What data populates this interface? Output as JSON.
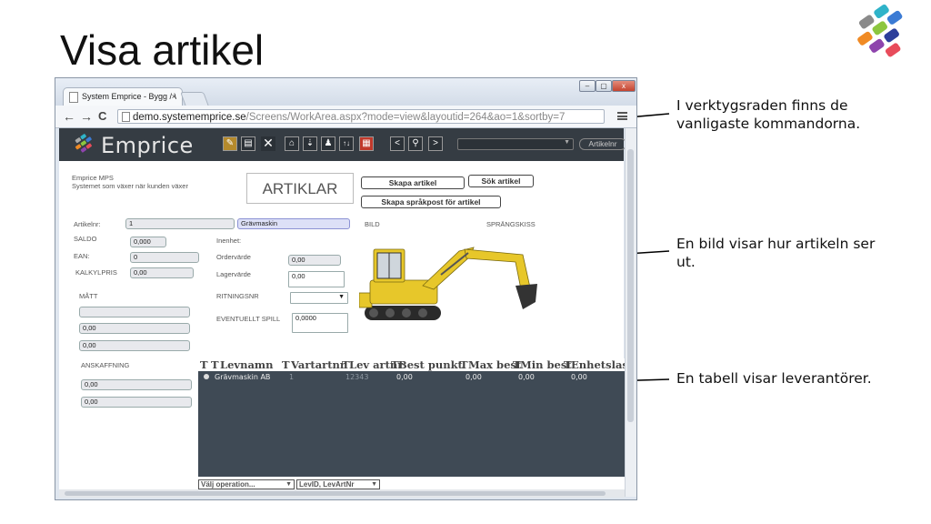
{
  "slide": {
    "title": "Visa artikel",
    "callouts": [
      "I verktygsraden finns de vanligaste kommandorna.",
      "En bild visar hur artikeln ser ut.",
      "En tabell visar leverantörer."
    ]
  },
  "browser": {
    "tab_title": "System Emprice - Bygg / \\",
    "tab_close": "×",
    "nav": {
      "back": "←",
      "forward": "→",
      "reload": "C"
    },
    "url_host": "demo.systememprice.se",
    "url_path": "/Screens/WorkArea.aspx?mode=view&layoutid=264&ao=1&sortby=7",
    "window_buttons": [
      "–",
      "▢",
      "x"
    ]
  },
  "app": {
    "logo": "Emprice",
    "toolbar_icons": [
      "edit-icon",
      "save-icon",
      "close-icon",
      "home-icon",
      "down-icon",
      "person-icon",
      "sort-icon",
      "pdf-icon",
      "prev-icon",
      "search-icon",
      "next-icon"
    ],
    "toolbar_glyphs": [
      "✎",
      "▤",
      "✕",
      "⌂",
      "⇣",
      "♟",
      "↑↓",
      "▦",
      "<",
      "⚲",
      ">"
    ],
    "search_button": "Artikelnr",
    "company_name": "Emprice MPS",
    "company_tagline": "Systemet som växer när kunden växer",
    "page_heading": "ARTIKLAR",
    "buttons": {
      "create_article": "Skapa artikel",
      "search_article": "Sök artikel",
      "create_language": "Skapa språkpost för artikel"
    },
    "fields": {
      "artikelnr_label": "Artikelnr:",
      "artikelnr_value": "1",
      "artikel_name": "Grävmaskin",
      "saldo_label": "SALDO",
      "saldo_value": "0,000",
      "ean_label": "EAN:",
      "ean_value": "0",
      "kalkylpris_label": "KALKYLPRIS",
      "kalkylpris_value": "0,00",
      "matt_label": "MÅTT",
      "matt_values": [
        "",
        "0,00",
        "0,00"
      ],
      "anskaffning_label": "ANSKAFFNING",
      "anskaffning_values": [
        "0,00",
        "0,00"
      ],
      "inenhet_label": "Inenhet:",
      "ordervarde_label": "Ordervärde",
      "ordervarde_value": "0,00",
      "lagervarde_label": "Lagervärde",
      "lagervarde_value": "0,00",
      "ritningsnr_label": "RITNINGSNR",
      "spill_label": "EVENTUELLT SPILL",
      "spill_value": "0,0000",
      "bild_label": "BILD",
      "sprangskiss_label": "SPRÄNGSKISS"
    },
    "grid": {
      "filter_glyph": "T",
      "columns": [
        "Levnamn",
        "Vartartnr",
        "Lev artnr",
        "Best punkt",
        "Max best",
        "Min best",
        "Enhetslast"
      ],
      "rows": [
        {
          "levnamn": "Grävmaskin AB",
          "vartartnr": "1",
          "levartnr": "12343",
          "bestpunkt": "0,00",
          "maxbest": "0,00",
          "minbest": "0,00",
          "enhetslast": "0,00"
        }
      ],
      "operation_select": "Välj operation...",
      "sort_select": "LevID, LevArtNr"
    }
  },
  "colors": {
    "header_bg": "#353c43",
    "grid_bg": "#3f4a55",
    "field_bg": "#e8e9ed",
    "logo_blue": "#3b7bd4",
    "logo_green": "#8cc63f",
    "logo_orange": "#f08a24",
    "logo_purple": "#8e44ad",
    "excavator_yellow": "#e7c72a"
  }
}
